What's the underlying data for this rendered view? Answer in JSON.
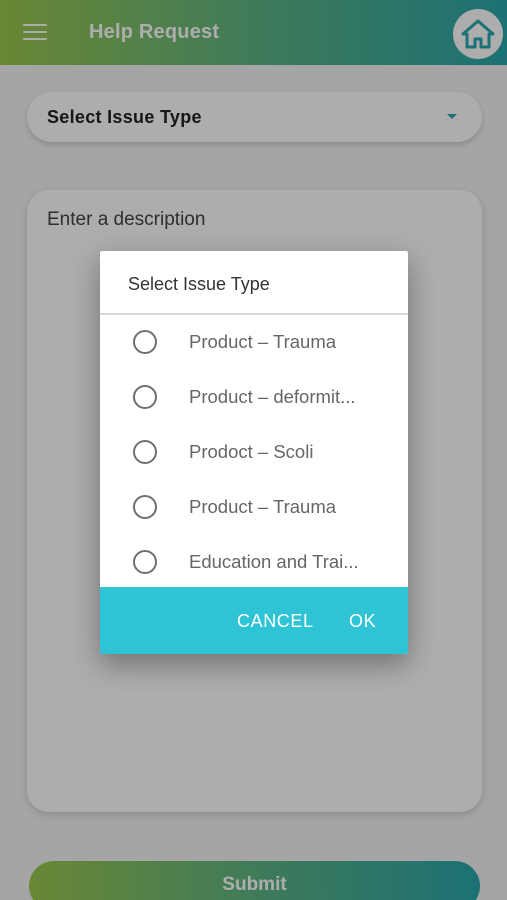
{
  "app_bar": {
    "title": "Help Request",
    "menu_icon": "hamburger-menu-icon",
    "home_icon": "home-icon",
    "gradient_start": "#9cc94e",
    "gradient_end": "#2aa7ab"
  },
  "form": {
    "issue_type_value": "Select Issue Type",
    "description_placeholder": "Enter a description",
    "submit_label": "Submit"
  },
  "dialog": {
    "title": "Select Issue Type",
    "options": [
      {
        "label": "Product – Trauma",
        "selected": false
      },
      {
        "label": "Product – deformit...",
        "selected": false
      },
      {
        "label": "Prodoct – Scoli",
        "selected": false
      },
      {
        "label": "Product – Trauma",
        "selected": false
      },
      {
        "label": "Education and Trai...",
        "selected": false
      }
    ],
    "cancel_label": "CANCEL",
    "ok_label": "OK",
    "action_bar_color": "#2fc3d6"
  }
}
